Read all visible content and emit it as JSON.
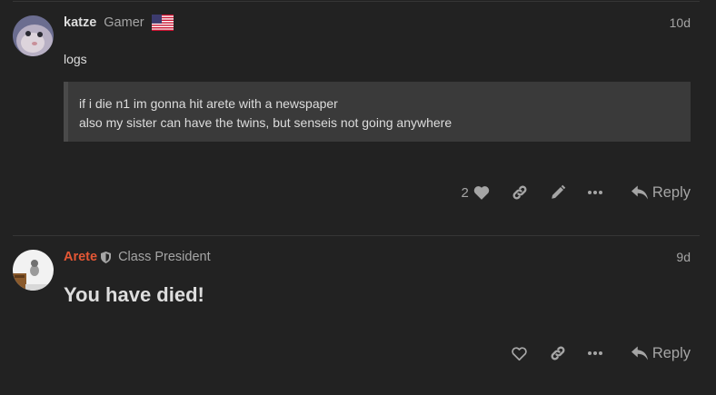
{
  "posts": [
    {
      "username": "katze",
      "user_title": "Gamer",
      "flag_icon": "us-flag-icon",
      "date": "10d",
      "body": "logs",
      "quote_lines": [
        "if i die n1 im gonna hit arete with a newspaper",
        "also my sister can have the twins, but senseis not going anywhere"
      ],
      "like_count": "2",
      "reply_label": "Reply"
    },
    {
      "username": "Arete",
      "user_title": "Class President",
      "badge_icon": "shield-icon",
      "date": "9d",
      "heading": "You have died!",
      "reply_label": "Reply"
    }
  ],
  "colors": {
    "background": "#222222",
    "text": "#dddddd",
    "muted": "#a5a5a5",
    "staff_name": "#e45735",
    "quote_bg": "#3a3a3a"
  }
}
